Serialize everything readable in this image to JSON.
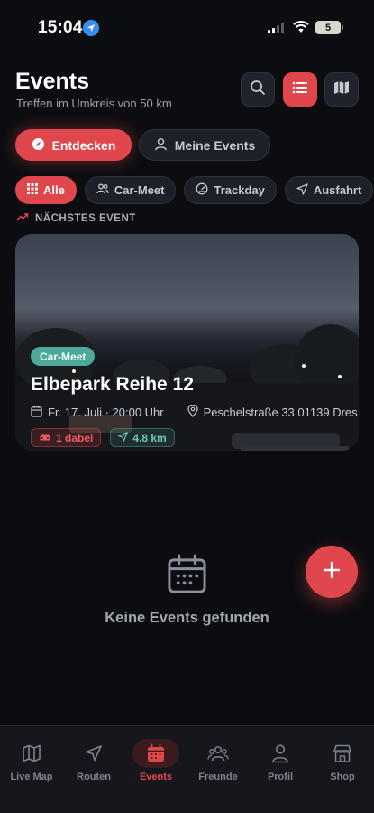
{
  "status_bar": {
    "time": "15:04",
    "battery": "5"
  },
  "header": {
    "title": "Events",
    "subtitle": "Treffen im Umkreis von 50 km"
  },
  "segments": [
    {
      "label": "Entdecken",
      "active": true
    },
    {
      "label": "Meine Events",
      "active": false
    }
  ],
  "filters": [
    {
      "label": "Alle",
      "icon": "grid-icon",
      "active": true
    },
    {
      "label": "Car-Meet",
      "icon": "people-icon",
      "active": false
    },
    {
      "label": "Trackday",
      "icon": "speedometer-icon",
      "active": false
    },
    {
      "label": "Ausfahrt",
      "icon": "navigation-icon",
      "active": false
    }
  ],
  "section_label": "NÄCHSTES EVENT",
  "event": {
    "type": "Car-Meet",
    "title": "Elbepark Reihe 12",
    "date": "Fr. 17. Juli · 20:00 Uhr",
    "location": "Peschelstraße 33 01139 Dres...",
    "attendees": "1 dabei",
    "distance": "4.8 km"
  },
  "empty_state": {
    "text": "Keine Events gefunden"
  },
  "tab_bar": [
    {
      "label": "Live Map",
      "icon": "map-icon",
      "active": false
    },
    {
      "label": "Routen",
      "icon": "navigation-icon",
      "active": false
    },
    {
      "label": "Events",
      "icon": "calendar-icon",
      "active": true
    },
    {
      "label": "Freunde",
      "icon": "friends-icon",
      "active": false
    },
    {
      "label": "Profil",
      "icon": "profile-icon",
      "active": false
    },
    {
      "label": "Shop",
      "icon": "shop-icon",
      "active": false
    }
  ],
  "colors": {
    "accent": "#e0474c",
    "teal": "#4fa89b",
    "background": "#0c0d11"
  }
}
